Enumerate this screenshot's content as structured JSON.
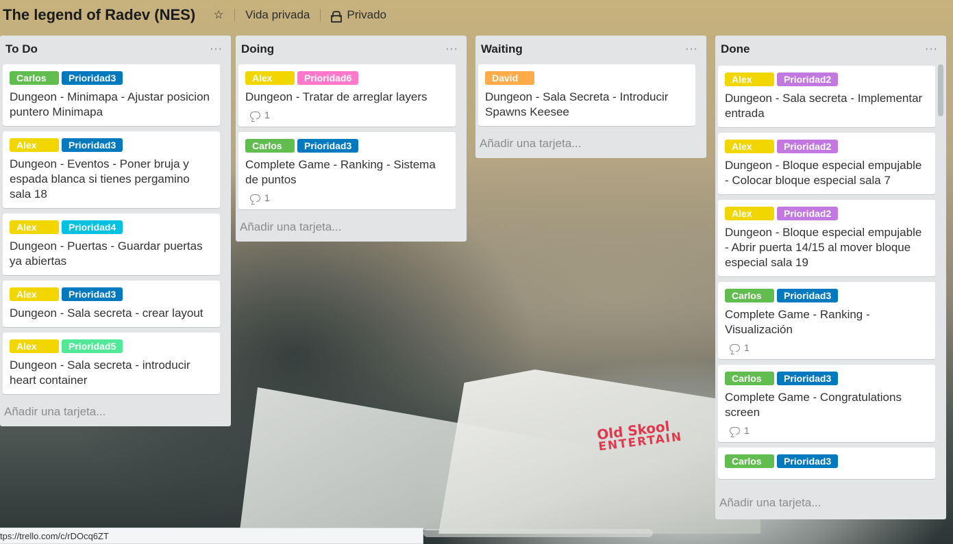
{
  "board": {
    "title": "The legend of Radev (NES)",
    "visibility_team": "Vida privada",
    "visibility": "Privado"
  },
  "colors": {
    "green": "#61bd4f",
    "blue": "#0079bf",
    "yellow": "#f2d600",
    "orange": "#ffab4a",
    "purple": "#c377e0",
    "pink": "#ff78cb",
    "sky": "#00c2e0",
    "lime": "#51e898"
  },
  "background_logo": {
    "line1": "Old Skool",
    "line2": "ENTERTAIN"
  },
  "lists": [
    {
      "title": "To Do",
      "menu": "···",
      "add_card": "Añadir una tarjeta...",
      "cards": [
        {
          "labels": [
            {
              "text": "Carlos",
              "color": "#61bd4f"
            },
            {
              "text": "Prioridad3",
              "color": "#0079bf"
            }
          ],
          "title": "Dungeon - Minimapa - Ajustar posicion puntero Minimapa",
          "comments": null
        },
        {
          "labels": [
            {
              "text": "Alex",
              "color": "#f2d600"
            },
            {
              "text": "Prioridad3",
              "color": "#0079bf"
            }
          ],
          "title": "Dungeon - Eventos - Poner bruja y espada blanca si tienes pergamino sala 18",
          "comments": null
        },
        {
          "labels": [
            {
              "text": "Alex",
              "color": "#f2d600"
            },
            {
              "text": "Prioridad4",
              "color": "#00c2e0"
            }
          ],
          "title": "Dungeon - Puertas - Guardar puertas ya abiertas",
          "comments": null
        },
        {
          "labels": [
            {
              "text": "Alex",
              "color": "#f2d600"
            },
            {
              "text": "Prioridad3",
              "color": "#0079bf"
            }
          ],
          "title": "Dungeon - Sala secreta - crear layout",
          "comments": null
        },
        {
          "labels": [
            {
              "text": "Alex",
              "color": "#f2d600"
            },
            {
              "text": "Prioridad5",
              "color": "#51e898"
            }
          ],
          "title": "Dungeon - Sala secreta - introducir heart container",
          "comments": null
        }
      ]
    },
    {
      "title": "Doing",
      "menu": "···",
      "add_card": "Añadir una tarjeta...",
      "cards": [
        {
          "labels": [
            {
              "text": "Alex",
              "color": "#f2d600"
            },
            {
              "text": "Prioridad6",
              "color": "#ff78cb"
            }
          ],
          "title": "Dungeon - Tratar de arreglar layers",
          "comments": "1"
        },
        {
          "labels": [
            {
              "text": "Carlos",
              "color": "#61bd4f"
            },
            {
              "text": "Prioridad3",
              "color": "#0079bf"
            }
          ],
          "title": "Complete Game - Ranking - Sistema de puntos",
          "comments": "1"
        }
      ]
    },
    {
      "title": "Waiting",
      "menu": "···",
      "add_card": "Añadir una tarjeta...",
      "cards": [
        {
          "labels": [
            {
              "text": "David",
              "color": "#ffab4a"
            }
          ],
          "title": "Dungeon - Sala Secreta - Introducir Spawns Keesee",
          "comments": null
        }
      ]
    },
    {
      "title": "Done",
      "menu": "···",
      "add_card": "Añadir una tarjeta...",
      "cards": [
        {
          "labels": [
            {
              "text": "Alex",
              "color": "#f2d600"
            },
            {
              "text": "Prioridad2",
              "color": "#c377e0"
            }
          ],
          "title": "Dungeon - Sala secreta - Implementar entrada",
          "comments": null
        },
        {
          "labels": [
            {
              "text": "Alex",
              "color": "#f2d600"
            },
            {
              "text": "Prioridad2",
              "color": "#c377e0"
            }
          ],
          "title": "Dungeon - Bloque especial empujable - Colocar bloque especial sala 7",
          "comments": null
        },
        {
          "labels": [
            {
              "text": "Alex",
              "color": "#f2d600"
            },
            {
              "text": "Prioridad2",
              "color": "#c377e0"
            }
          ],
          "title": "Dungeon - Bloque especial empujable - Abrir puerta 14/15 al mover bloque especial sala 19",
          "comments": null
        },
        {
          "labels": [
            {
              "text": "Carlos",
              "color": "#61bd4f"
            },
            {
              "text": "Prioridad3",
              "color": "#0079bf"
            }
          ],
          "title": "Complete Game - Ranking - Visualización",
          "comments": "1"
        },
        {
          "labels": [
            {
              "text": "Carlos",
              "color": "#61bd4f"
            },
            {
              "text": "Prioridad3",
              "color": "#0079bf"
            }
          ],
          "title": "Complete Game - Congratulations screen",
          "comments": "1"
        },
        {
          "labels": [
            {
              "text": "Carlos",
              "color": "#61bd4f"
            },
            {
              "text": "Prioridad3",
              "color": "#0079bf"
            }
          ],
          "title": "",
          "comments": null
        }
      ]
    }
  ],
  "status_bar": {
    "url": "tps://trello.com/c/rDOcq6ZT"
  }
}
